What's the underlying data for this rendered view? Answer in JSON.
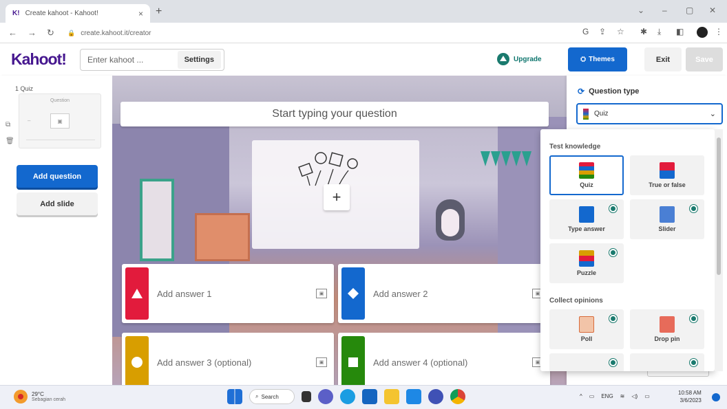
{
  "browser": {
    "tab_title": "Create kahoot - Kahoot!",
    "tab_favicon": "K!",
    "tab_close": "×",
    "new_tab": "+",
    "url": "create.kahoot.it/creator",
    "window_controls": [
      "⌄",
      "–",
      "▢",
      "✕"
    ]
  },
  "header": {
    "logo": "Kahoot!",
    "title_placeholder": "Enter kahoot ...",
    "settings_label": "Settings",
    "upgrade_label": "Upgrade",
    "themes_label": "Themes",
    "exit_label": "Exit",
    "save_label": "Save"
  },
  "sidebar": {
    "slide_label": "1 Quiz",
    "thumb_text": "Question",
    "add_question_label": "Add question",
    "add_slide_label": "Add slide"
  },
  "editor": {
    "question_placeholder": "Start typing your question",
    "media_plus": "+",
    "answers": [
      {
        "label": "Add answer 1",
        "color": "#e21b3c",
        "shape": "triangle"
      },
      {
        "label": "Add answer 2",
        "color": "#1368ce",
        "shape": "diamond"
      },
      {
        "label": "Add answer 3 (optional)",
        "color": "#d89e00",
        "shape": "circle"
      },
      {
        "label": "Add answer 4 (optional)",
        "color": "#26890c",
        "shape": "square"
      }
    ]
  },
  "question_type": {
    "label": "Question type",
    "selected": "Quiz",
    "sections": [
      {
        "title": "Test knowledge",
        "options": [
          "Quiz",
          "True or false",
          "Type answer",
          "Slider",
          "Puzzle"
        ]
      },
      {
        "title": "Collect opinions",
        "options": [
          "Poll",
          "Drop pin"
        ]
      }
    ]
  },
  "taskbar": {
    "weather_temp": "29°C",
    "weather_desc": "Sebagian cerah",
    "search_label": "Search",
    "lang": "ENG",
    "time": "10:58 AM",
    "date": "3/6/2023"
  },
  "colors": {
    "kahoot_purple": "#46178f",
    "primary_blue": "#1368ce",
    "red": "#e21b3c",
    "yellow": "#d89e00",
    "green": "#26890c"
  }
}
